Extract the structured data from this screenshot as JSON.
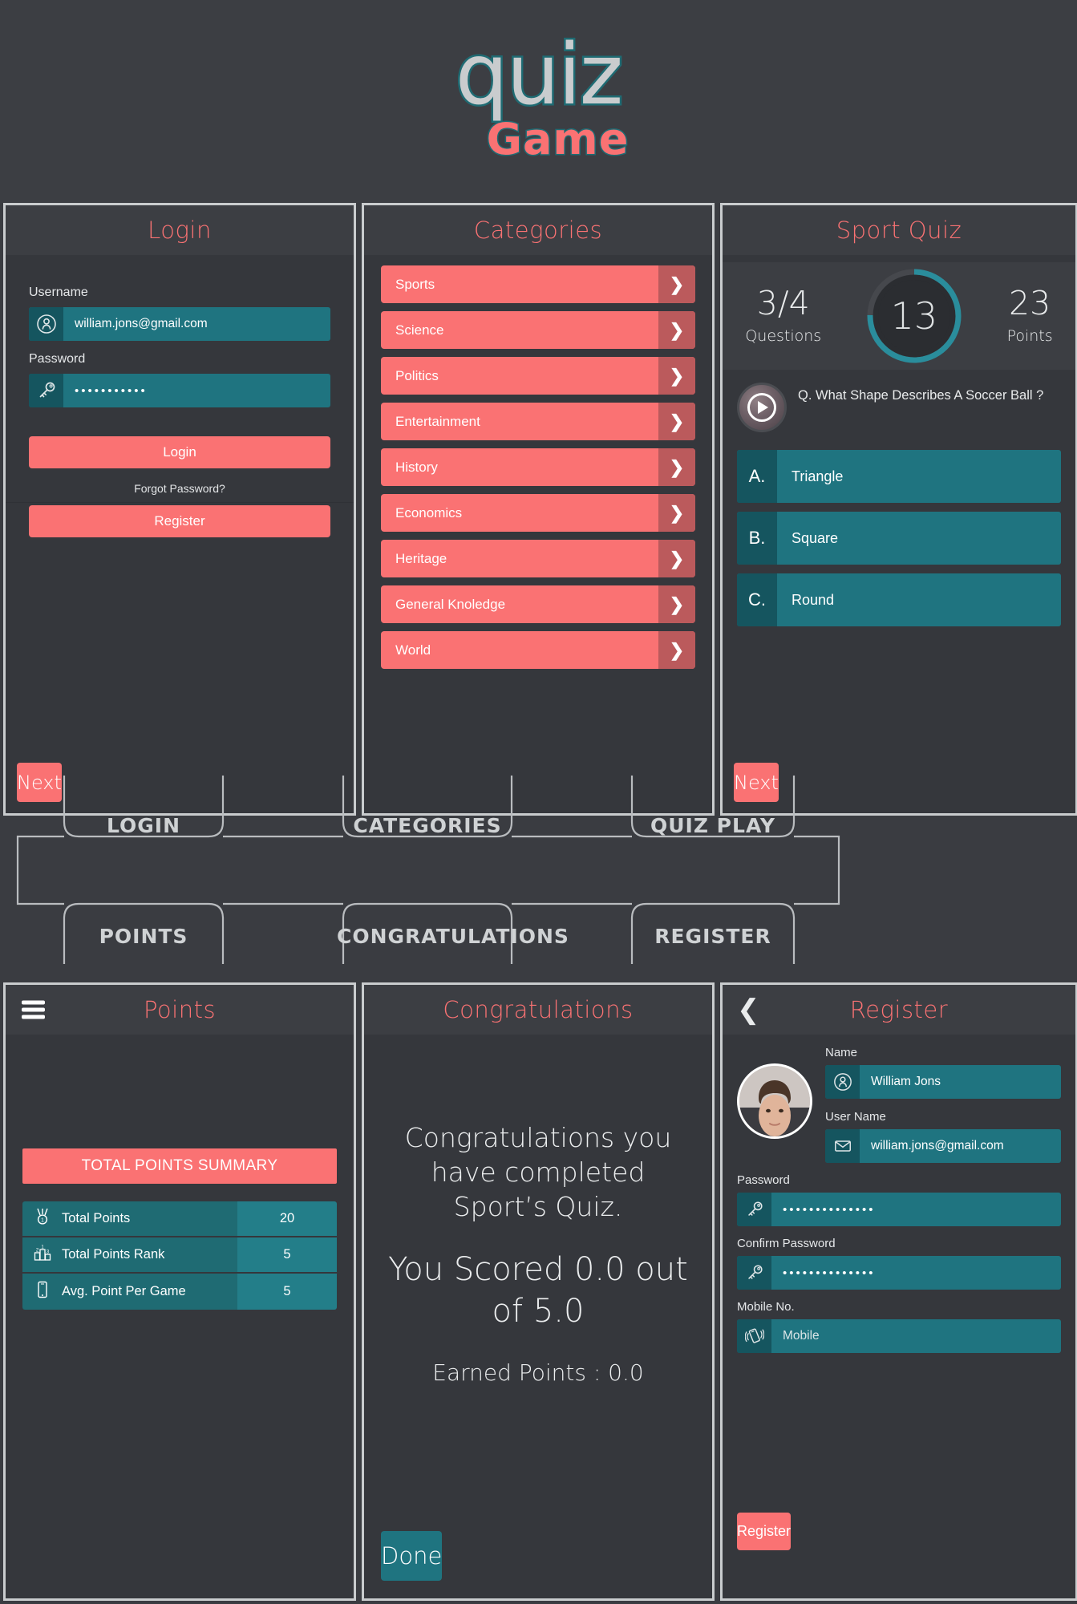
{
  "logo": {
    "word1": "quiz",
    "word2": "Game"
  },
  "login": {
    "title": "Login",
    "username_label": "Username",
    "username_value": "william.jons@gmail.com",
    "password_label": "Password",
    "password_value": "•••••••••••",
    "login_button": "Login",
    "forgot_link": "Forgot Password?",
    "register_button": "Register",
    "next_button": "Next",
    "user_icon": "user-icon",
    "key_icon": "key-icon"
  },
  "categories": {
    "title": "Categories",
    "arrow_icon": "chevron-right-icon",
    "items": [
      {
        "label": "Sports"
      },
      {
        "label": "Science"
      },
      {
        "label": "Politics"
      },
      {
        "label": "Entertainment"
      },
      {
        "label": "History"
      },
      {
        "label": "Economics"
      },
      {
        "label": "Heritage"
      },
      {
        "label": "General Knoledge"
      },
      {
        "label": "World"
      }
    ]
  },
  "quiz": {
    "title": "Sport Quiz",
    "questions_value": "3/4",
    "questions_label": "Questions",
    "timer_value": "13",
    "points_value": "23",
    "points_label": "Points",
    "question_text": "Q. What Shape Describes A Soccer Ball ?",
    "play_icon": "play-icon",
    "answers": [
      {
        "key": "A.",
        "text": "Triangle"
      },
      {
        "key": "B.",
        "text": "Square"
      },
      {
        "key": "C.",
        "text": "Round"
      }
    ],
    "next_button": "Next"
  },
  "flow": {
    "boxes": [
      {
        "label": "LOGIN"
      },
      {
        "label": "CATEGORIES"
      },
      {
        "label": "QUIZ PLAY"
      },
      {
        "label": "POINTS"
      },
      {
        "label": "CONGRATULATIONS"
      },
      {
        "label": "REGISTER"
      }
    ]
  },
  "points": {
    "title": "Points",
    "menu_icon": "hamburger-menu-icon",
    "summary_header": "TOTAL POINTS SUMMARY",
    "rows": [
      {
        "icon": "medal-icon",
        "label": "Total Points",
        "value": "20"
      },
      {
        "icon": "podium-icon",
        "label": "Total Points Rank",
        "value": "5"
      },
      {
        "icon": "mobile-icon",
        "label": "Avg. Point Per Game",
        "value": "5"
      }
    ]
  },
  "congratulations": {
    "title": "Congratulations",
    "line1": "Congratulations you have completed Sport’s Quiz.",
    "line2": "You Scored 0.0 out of 5.0",
    "line3": "Earned Points : 0.0",
    "done_button": "Done"
  },
  "register": {
    "title": "Register",
    "back_icon": "chevron-left-icon",
    "avatar": "user-avatar",
    "name_label": "Name",
    "name_value": "William Jons",
    "username_label": "User Name",
    "username_value": "william.jons@gmail.com",
    "password_label": "Password",
    "password_value": "••••••••••••••",
    "confirm_label": "Confirm Password",
    "confirm_value": "••••••••••••••",
    "mobile_label": "Mobile No.",
    "mobile_placeholder": "Mobile",
    "register_button": "Register",
    "user_icon": "user-icon",
    "mail_icon": "mail-icon",
    "key_icon": "key-icon",
    "phone_icon": "phone-vibrate-icon"
  },
  "colors": {
    "accent_red": "#fa7273",
    "accent_teal": "#1f7480",
    "bg": "#3a3c41"
  }
}
